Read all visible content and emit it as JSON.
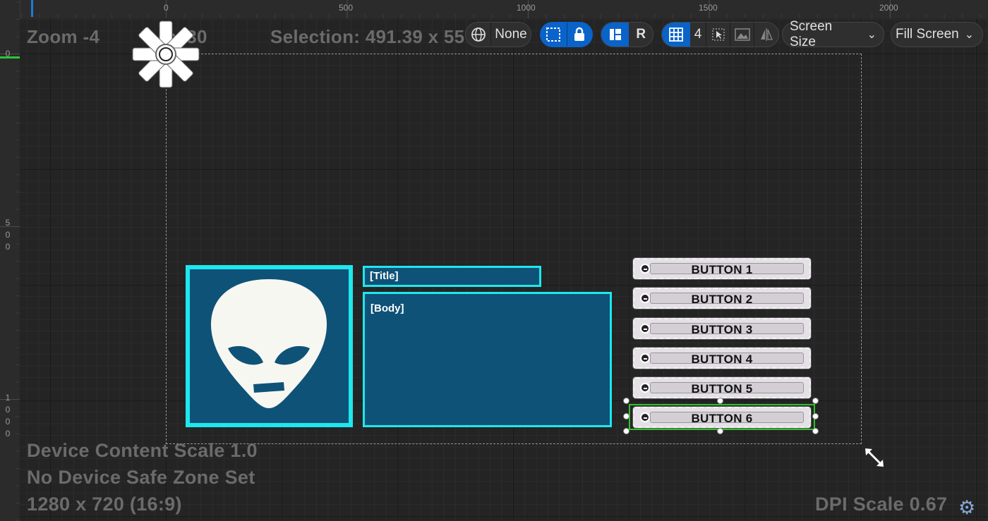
{
  "ruler": {
    "top_labels": [
      "0",
      "500",
      "1000",
      "1500",
      "2000"
    ],
    "left_labels": [
      [
        "0"
      ],
      [
        "5",
        "0",
        "0"
      ],
      [
        "1",
        "0",
        "0",
        "0"
      ]
    ]
  },
  "overlay": {
    "zoom": "Zoom -4",
    "size": "x 30",
    "selection": "Selection: 491.39 x 55",
    "content_scale": "Device Content Scale 1.0",
    "safe_zone": "No Device Safe Zone Set",
    "resolution": "1280 x 720 (16:9)",
    "dpi_scale": "DPI Scale 0.67"
  },
  "toolbar": {
    "localization_value": "None",
    "respect_locks_label": "R",
    "grid_snap_value": "4",
    "screen_size_label": "Screen Size",
    "fill_screen_label": "Fill Screen"
  },
  "widgets": {
    "title_text": "[Title]",
    "body_text": "[Body]",
    "buttons": [
      "BUTTON 1",
      "BUTTON 2",
      "BUTTON 3",
      "BUTTON 4",
      "BUTTON 5",
      "BUTTON 6"
    ]
  },
  "colors": {
    "accent_blue": "#0a63c9",
    "widget_fill": "#0f5277",
    "widget_border": "#1ee7ee",
    "selection_green": "#2ec32a"
  },
  "icons": {
    "localization": "globe-icon",
    "marquee": "marquee-select-icon",
    "lock": "lock-icon",
    "respect_locks": "layout-icon",
    "grid": "grid-icon",
    "pointer": "pointer-icon",
    "background": "image-icon",
    "mirror": "flip-icon",
    "settings": "gear-icon",
    "resize": "resize-arrow-icon",
    "anchor": "anchor-icon"
  }
}
